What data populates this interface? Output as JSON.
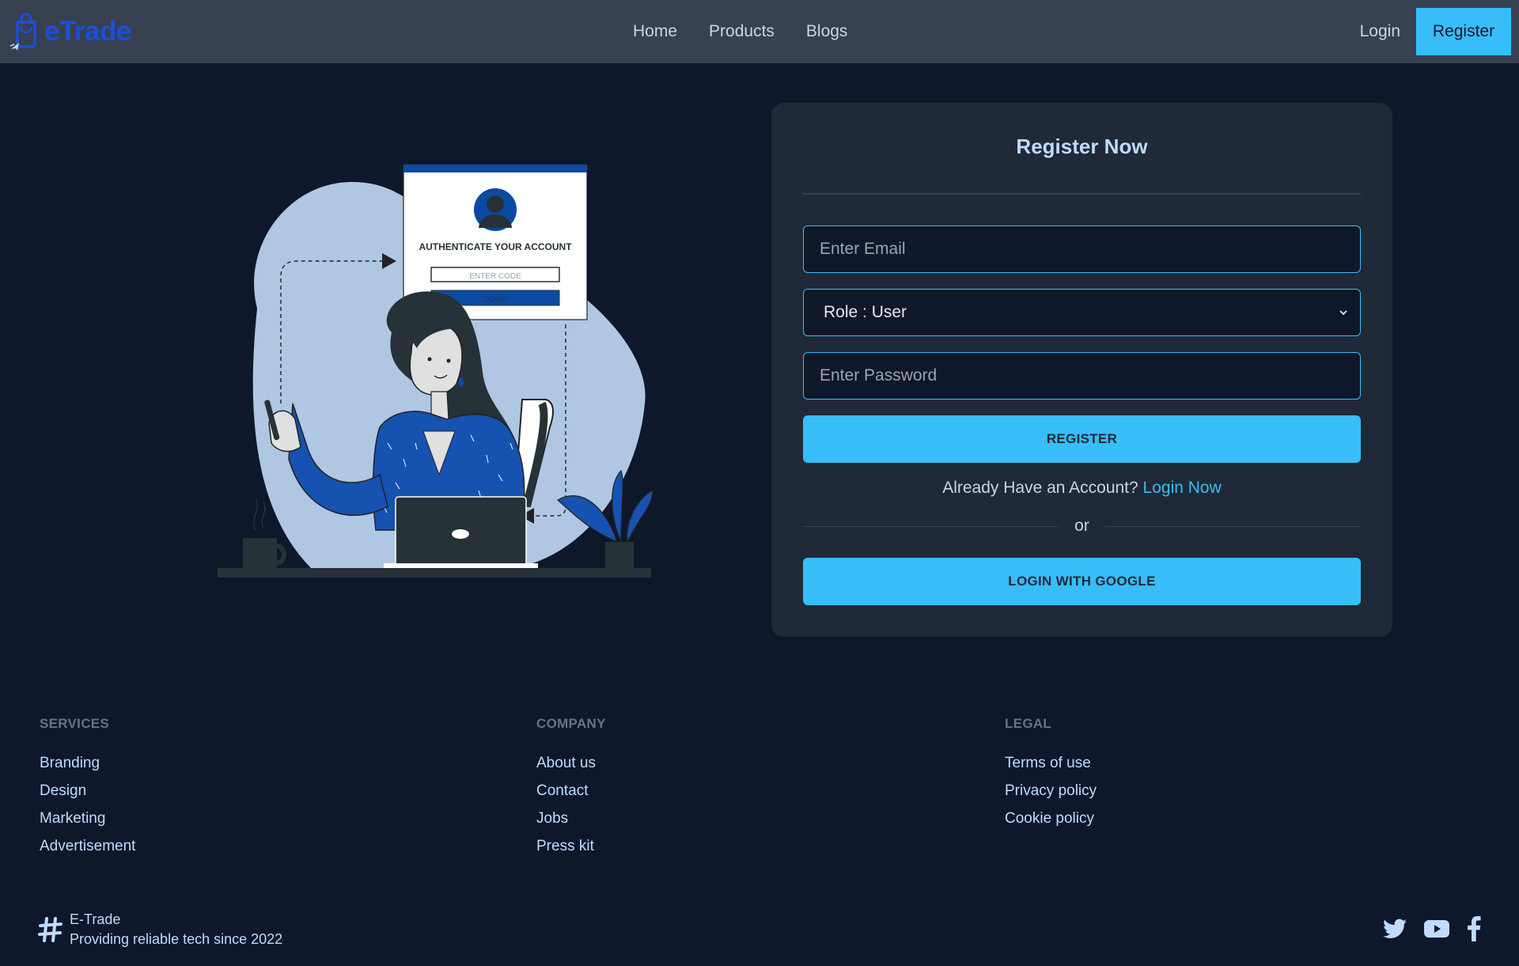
{
  "nav": {
    "logo_text": "eTrade",
    "links": [
      "Home",
      "Products",
      "Blogs"
    ],
    "login": "Login",
    "register": "Register"
  },
  "illustration": {
    "heading": "AUTHENTICATE YOUR ACCOUNT",
    "code_placeholder": "ENTER CODE",
    "done": "DONE"
  },
  "form": {
    "title": "Register Now",
    "email_placeholder": "Enter Email",
    "role_value": "Role : User",
    "password_placeholder": "Enter Password",
    "register_button": "REGISTER",
    "have_account": "Already Have an Account?",
    "login_now": "Login Now",
    "or": "or",
    "google_button": "LOGIN WITH GOOGLE"
  },
  "footer": {
    "services": {
      "title": "SERVICES",
      "items": [
        "Branding",
        "Design",
        "Marketing",
        "Advertisement"
      ]
    },
    "company": {
      "title": "COMPANY",
      "items": [
        "About us",
        "Contact",
        "Jobs",
        "Press kit"
      ]
    },
    "legal": {
      "title": "LEGAL",
      "items": [
        "Terms of use",
        "Privacy policy",
        "Cookie policy"
      ]
    },
    "brand_name": "E-Trade",
    "tagline": "Providing reliable tech since 2022",
    "socials": [
      "twitter-icon",
      "youtube-icon",
      "facebook-icon"
    ]
  },
  "colors": {
    "background": "#0f172a",
    "navbar": "#374151",
    "accent": "#38bdf8",
    "card": "#1f2937"
  }
}
